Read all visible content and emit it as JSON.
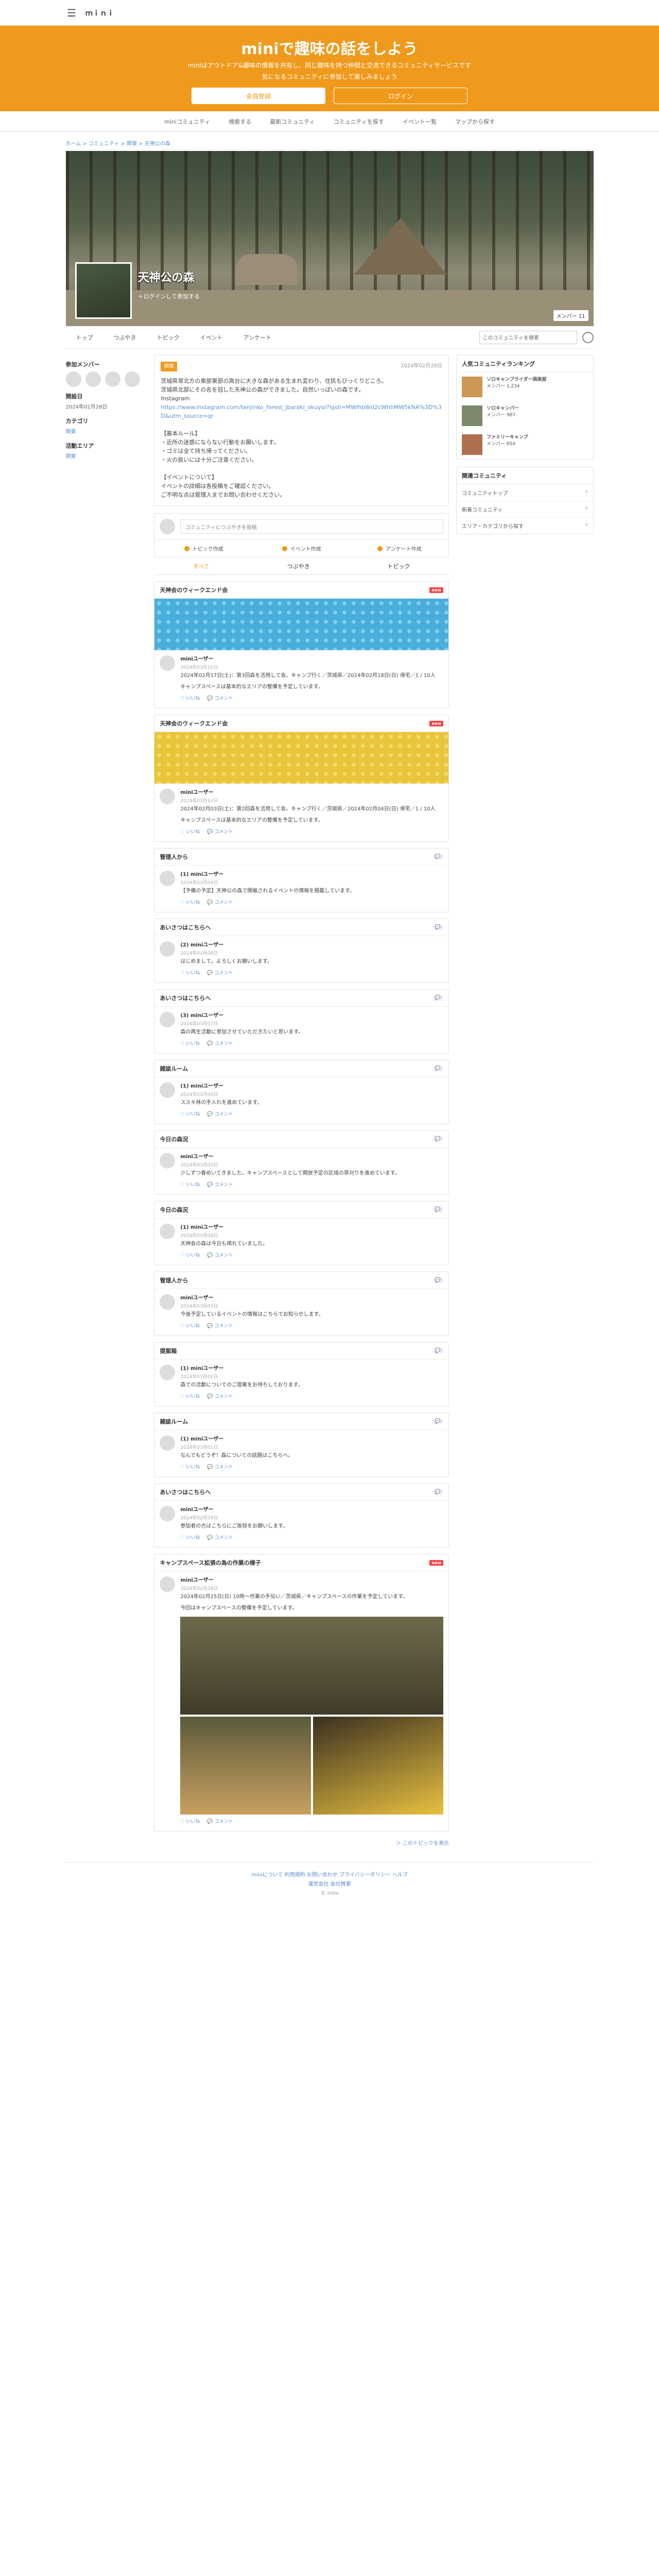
{
  "header": {
    "logo": "ｍｉｎｉ",
    "menu_icon": "menu-icon"
  },
  "hero": {
    "title": "miniで趣味の話をしよう",
    "line1": "miniはアウトドア&趣味の情報を共有し、同じ趣味を持つ仲間と交流できるコミュニティサービスです",
    "line2": "気になるコミュニティに参加して楽しみましょう",
    "register": "会員登録",
    "login": "ログイン",
    "accent": "#ef9a1c"
  },
  "mainnav": [
    "miniコミュニティ",
    "検索する",
    "最新コミュニティ",
    "コミュニティを探す",
    "イベント一覧",
    "マップから探す"
  ],
  "breadcrumb": "ホーム > コミュニティ > 関東 > 天神公の森",
  "community": {
    "name": "天神公の森",
    "follow": "＋ログインして参加する",
    "members": "メンバー 11"
  },
  "tabs": [
    "トップ",
    "つぶやき",
    "トピック",
    "イベント",
    "アンケート"
  ],
  "tabs_select": "このコミュニティを検索",
  "left": {
    "members_h": "参加メンバー",
    "created_h": "開設日",
    "created": "2024年02月28日",
    "category_h": "カテゴリ",
    "category": "関東",
    "area_h": "活動エリア",
    "area": "関東"
  },
  "desc": {
    "tag": "関東",
    "date": "2024年02月28日",
    "p1": "茨城県常北方の東部東部の高台に大きな森がある生まれ変わり、住民もびっくりどころ。",
    "p2": "茨城県北部にその名を冠した天神公の森ができました。自然いっぱいの森です。",
    "p3": "Instagram",
    "link": "https://www.instagram.com/tenjinko_forest_jbaraki_okuyo/?igsh=MWlhbWd2cWhhMW5kNA%3D%3D&utm_source=qr",
    "p4": "【基本ルール】",
    "p5": "・近所の迷惑にならない行動をお願いします。",
    "p6": "・ゴミは全て持ち帰ってください。",
    "p7": "・火の扱いには十分ご注意ください。",
    "p8": "【イベントについて】",
    "p9": "イベントの詳細は各投稿をご確認ください。",
    "p10": "ご不明な点は管理人までお問い合わせください。"
  },
  "post": {
    "placeholder": "コミュニティにつぶやきを投稿",
    "btn_topic": "トピック作成",
    "btn_event": "イベント作成",
    "btn_survey": "アンケート作成"
  },
  "feed_tabs": [
    "すべて",
    "つぶやき",
    "トピック"
  ],
  "cards": [
    {
      "title": "天神会のウィークエンド会",
      "badge": "new",
      "banner": "blue",
      "user": "miniユーザー",
      "date": "2024年03月10日",
      "body": "2024年02月17日(土)：第3回森を活用して会。キャンプ行く／茨城県／2024年02月18日(日) 帰宅／1 / 10人",
      "note": "キャンプスペースは基本的なエリアの整備を予定しています。"
    },
    {
      "title": "天神会のウィークエンド会",
      "badge": "new",
      "banner": "yellow",
      "user": "miniユーザー",
      "date": "2024年03月10日",
      "body": "2024年02月03日(土)：第2回森を活用して会。キャンプ行く／茨城県／2024年02月04日(日) 帰宅／1 / 10人",
      "note": "キャンプスペースは基本的なエリアの整備を予定しています。"
    },
    {
      "title": "管理人から",
      "user": "(1) miniユーザー",
      "date": "2024年03月09日",
      "body": "【予備の予定】天神公の森で開催されるイベントの情報を掲載しています。"
    },
    {
      "title": "あいさつはこちらへ",
      "user": "(2) miniユーザー",
      "date": "2024年03月08日",
      "body": "はじめまして。よろしくお願いします。"
    },
    {
      "title": "あいさつはこちらへ",
      "user": "(3) miniユーザー",
      "date": "2024年03月07日",
      "body": "森の再生活動に参加させていただきたいと思います。"
    },
    {
      "title": "雑談ルーム",
      "user": "(1) miniユーザー",
      "date": "2024年03月06日",
      "body": "ススキ林の手入れを進めています。"
    },
    {
      "title": "今日の森況",
      "user": "miniユーザー",
      "date": "2024年03月05日",
      "body": "少しずつ春めいてきました。キャンプスペースとして開放予定の区域の草刈りを進めています。"
    },
    {
      "title": "今日の森況",
      "user": "(1) miniユーザー",
      "date": "2024年03月04日",
      "body": "天神会の森は今日も晴れていました。"
    },
    {
      "title": "管理人から",
      "user": "miniユーザー",
      "date": "2024年03月03日",
      "body": "今後予定しているイベントの情報はこちらでお知らせします。"
    },
    {
      "title": "提案箱",
      "user": "(1) miniユーザー",
      "date": "2024年03月02日",
      "body": "森での活動についてのご提案をお待ちしております。"
    },
    {
      "title": "雑談ルーム",
      "user": "(1) miniユーザー",
      "date": "2024年03月01日",
      "body": "なんでもどうぞ！森についての話題はこちらへ。"
    },
    {
      "title": "あいさつはこちらへ",
      "user": "miniユーザー",
      "date": "2024年02月29日",
      "body": "参加者の方はこちらにご挨拶をお願いします。"
    },
    {
      "title": "キャンプスペース拡張の為の作業の様子",
      "badge": "new",
      "user": "miniユーザー",
      "date": "2024年02月28日",
      "body": "2024年02月25日(日) 10時～作業の手伝い／茨城県／キャンプスペースの作業を予定しています。",
      "note": "今回はキャンプスペースの整備を予定しています。",
      "photos": true
    }
  ],
  "more": "＞ このトピックを表示",
  "right": {
    "ranking_h": "人気コミュニティランキング",
    "rank": [
      {
        "name": "ソロキャンプライダー倶楽部",
        "meta": "メンバー 1,234"
      },
      {
        "name": "ソロキャンパー",
        "meta": "メンバー 987"
      },
      {
        "name": "ファミリーキャンプ",
        "meta": "メンバー 654"
      }
    ],
    "links_h": "関連コミュニティ",
    "links": [
      "コミュニティトップ",
      "新着コミュニティ",
      "エリア・カテゴリから探す"
    ]
  },
  "footer": {
    "links1": "miniについて  利用規約  お問い合わせ  プライバシーポリシー  ヘルプ",
    "links2": "運営会社  会社概要",
    "copy": "© mini"
  }
}
